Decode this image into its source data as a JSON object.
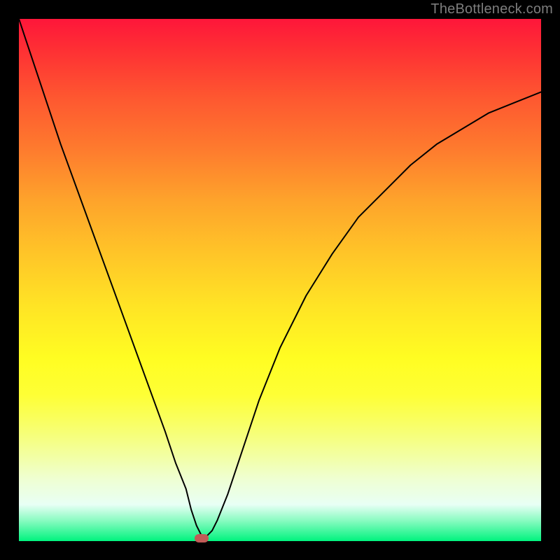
{
  "attribution": "TheBottleneck.com",
  "chart_data": {
    "type": "line",
    "title": "",
    "xlabel": "",
    "ylabel": "",
    "xlim": [
      0,
      100
    ],
    "ylim": [
      0,
      100
    ],
    "series": [
      {
        "name": "bottleneck-curve",
        "x": [
          0,
          2,
          5,
          8,
          12,
          16,
          20,
          24,
          28,
          30,
          32,
          33,
          34,
          35,
          36,
          37,
          38,
          40,
          43,
          46,
          50,
          55,
          60,
          65,
          70,
          75,
          80,
          85,
          90,
          95,
          100
        ],
        "values": [
          100,
          94,
          85,
          76,
          65,
          54,
          43,
          32,
          21,
          15,
          10,
          6,
          3,
          1,
          1,
          2,
          4,
          9,
          18,
          27,
          37,
          47,
          55,
          62,
          67,
          72,
          76,
          79,
          82,
          84,
          86
        ]
      }
    ],
    "marker": {
      "x": 35,
      "y": 0.5,
      "color": "#c15b57"
    },
    "gradient_stops": [
      {
        "pos": 0,
        "color": "#fe163a"
      },
      {
        "pos": 100,
        "color": "#00f37e"
      }
    ]
  }
}
